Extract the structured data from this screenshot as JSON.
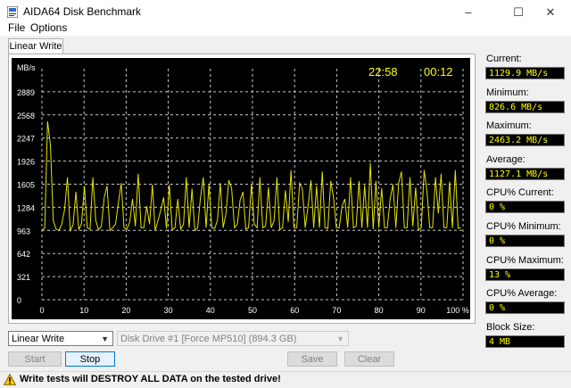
{
  "window": {
    "title": "AIDA64 Disk Benchmark",
    "minimize": "–",
    "maximize": "☐",
    "close": "✕"
  },
  "menu": {
    "file": "File",
    "options": "Options"
  },
  "tab": {
    "label": "Linear Write"
  },
  "chart": {
    "unit_label": "MB/s",
    "clock_time": "22:58",
    "elapsed_time": "00:12",
    "y_ticks": [
      "2889",
      "2568",
      "2247",
      "1926",
      "1605",
      "1284",
      "963",
      "642",
      "321",
      "0"
    ],
    "x_ticks": [
      "0",
      "10",
      "20",
      "30",
      "40",
      "50",
      "60",
      "70",
      "80",
      "90",
      "100 %"
    ],
    "colors": {
      "background": "#000000",
      "grid": "#c8c8c8",
      "line": "#e4e400",
      "text": "#ffffff",
      "clock": "#ffff00"
    }
  },
  "chart_data": {
    "type": "line",
    "ylabel": "MB/s",
    "xlabel": "",
    "ylim": [
      0,
      3210
    ],
    "xlim": [
      0,
      100
    ],
    "grid": true,
    "y_ticks": [
      0,
      321,
      642,
      963,
      1284,
      1605,
      1926,
      2247,
      2568,
      2889
    ],
    "x_ticks": [
      0,
      10,
      20,
      30,
      40,
      50,
      60,
      70,
      80,
      90,
      100
    ],
    "series": [
      {
        "values": [
          963,
          1000,
          2480,
          2150,
          1100,
          980,
          960,
          1050,
          1250,
          1700,
          960,
          1040,
          1500,
          970,
          1060,
          1580,
          1000,
          975,
          1700,
          1100,
          970,
          1020,
          1420,
          1580,
          960,
          1000,
          1050,
          1350,
          1620,
          1000,
          980,
          1080,
          1400,
          1020,
          1750,
          1000,
          1000,
          1300,
          1050,
          1600,
          960,
          1100,
          1250,
          1420,
          990,
          1600,
          970,
          1000,
          1400,
          980,
          1050,
          1700,
          1000,
          1540,
          960,
          1000,
          1420,
          1700,
          1000,
          1600,
          1000,
          990,
          1100,
          1620,
          1000,
          1200,
          1660,
          1550,
          1000,
          1050,
          1380,
          1500,
          980,
          1000,
          1600,
          1050,
          1000,
          1700,
          1000,
          1020,
          1560,
          1000,
          1100,
          1700,
          970,
          1000,
          1520,
          1080,
          1800,
          1000,
          1000,
          1620,
          1540,
          1000,
          1300,
          1660,
          1000,
          1580,
          1000,
          1780,
          1000,
          990,
          1650,
          1420,
          1000,
          1000,
          1300,
          1400,
          1000,
          1700,
          1000,
          1020,
          1650,
          1000,
          1590,
          1000,
          1900,
          980,
          1650,
          1000,
          1550,
          1000,
          1000,
          1400,
          1600,
          1000,
          1620,
          1780,
          1000,
          1000,
          1700,
          1020,
          1560,
          970,
          1000,
          1800,
          1500,
          1000,
          1000,
          1700,
          1200,
          1750,
          1000,
          1000,
          1640,
          1000,
          1800,
          990,
          1000
        ]
      }
    ]
  },
  "stats": [
    {
      "label": "Current:",
      "value": "1129.9 MB/s"
    },
    {
      "label": "Minimum:",
      "value": "826.6 MB/s"
    },
    {
      "label": "Maximum:",
      "value": "2463.2 MB/s"
    },
    {
      "label": "Average:",
      "value": "1127.1 MB/s"
    },
    {
      "label": "CPU% Current:",
      "value": "0 %"
    },
    {
      "label": "CPU% Minimum:",
      "value": "0 %"
    },
    {
      "label": "CPU% Maximum:",
      "value": "13 %"
    },
    {
      "label": "CPU% Average:",
      "value": "0 %"
    },
    {
      "label": "Block Size:",
      "value": "4 MB"
    }
  ],
  "controls": {
    "test_select": "Linear Write",
    "drive_select": "Disk Drive #1  [Force MP510]  (894.3 GB)",
    "start": "Start",
    "stop": "Stop",
    "save": "Save",
    "clear": "Clear"
  },
  "status": {
    "warning": "Write tests will DESTROY ALL DATA on the tested drive!"
  }
}
